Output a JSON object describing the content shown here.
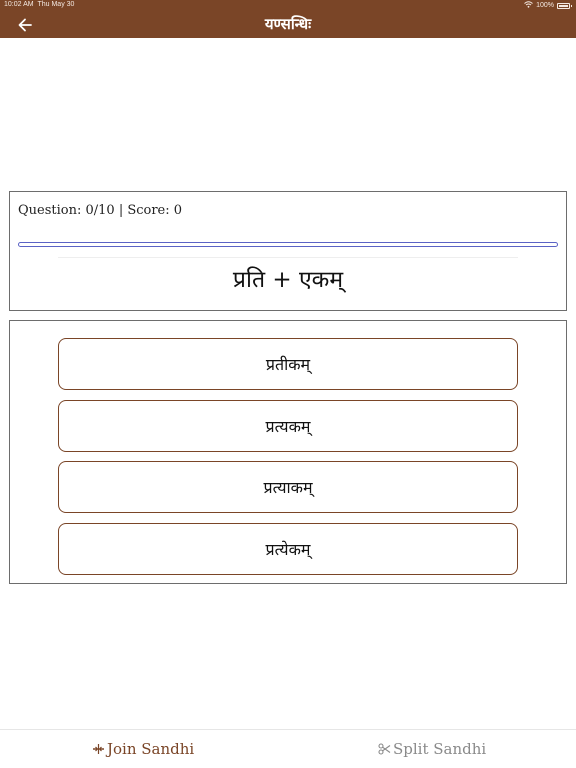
{
  "status_bar": {
    "time": "10:02 AM",
    "date": "Thu May 30",
    "battery": "100%"
  },
  "nav": {
    "title": "यण्सन्धिः",
    "back_icon": "arrow-left-icon"
  },
  "quiz": {
    "info": "Question: 0/10 | Score: 0",
    "progress": 0,
    "question": "प्रति + एकम्"
  },
  "options": [
    {
      "label": "प्रतीकम्"
    },
    {
      "label": "प्रत्यकम्"
    },
    {
      "label": "प्रत्याकम्"
    },
    {
      "label": "प्रत्येकम्"
    }
  ],
  "tabs": [
    {
      "label": "Join Sandhi",
      "icon": "join-icon",
      "active": true
    },
    {
      "label": "Split Sandhi",
      "icon": "scissors-icon",
      "active": false
    }
  ],
  "colors": {
    "nav_bg": "#7a4527",
    "accent": "#7a4527",
    "progress": "#5b63c5",
    "inactive_tab": "#8a8a8a"
  }
}
